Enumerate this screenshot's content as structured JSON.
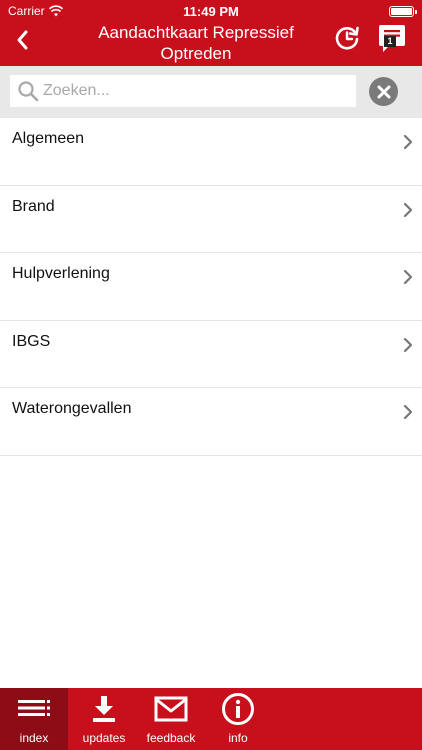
{
  "status_bar": {
    "carrier": "Carrier",
    "time": "11:49 PM",
    "icons": [
      "wifi-icon",
      "battery-icon"
    ]
  },
  "nav": {
    "back_icon": "chevron-left-icon",
    "title": "Aandachtkaart Repressief\nOptreden",
    "refresh_icon": "refresh-clock-icon",
    "notes_icon": "notes-icon",
    "notes_badge": "1"
  },
  "search": {
    "value": "",
    "placeholder": "Zoeken...",
    "search_icon": "search-icon",
    "clear_icon": "close-icon"
  },
  "list": {
    "items": [
      {
        "label": "Algemeen"
      },
      {
        "label": "Brand"
      },
      {
        "label": "Hulpverlening"
      },
      {
        "label": "IBGS"
      },
      {
        "label": "Waterongevallen"
      }
    ]
  },
  "tab_bar": {
    "active": "index",
    "tabs": [
      {
        "label": "index",
        "icon": "list-icon"
      },
      {
        "label": "updates",
        "icon": "download-icon"
      },
      {
        "label": "feedback",
        "icon": "mail-icon"
      },
      {
        "label": "info",
        "icon": "info-icon"
      }
    ]
  },
  "colors": {
    "brand_red": "#c8101d",
    "active_tab": "#8e0c15",
    "search_background": "#e8e8e8",
    "clear_button": "#7a7a7a",
    "divider": "#e4e4e4"
  }
}
